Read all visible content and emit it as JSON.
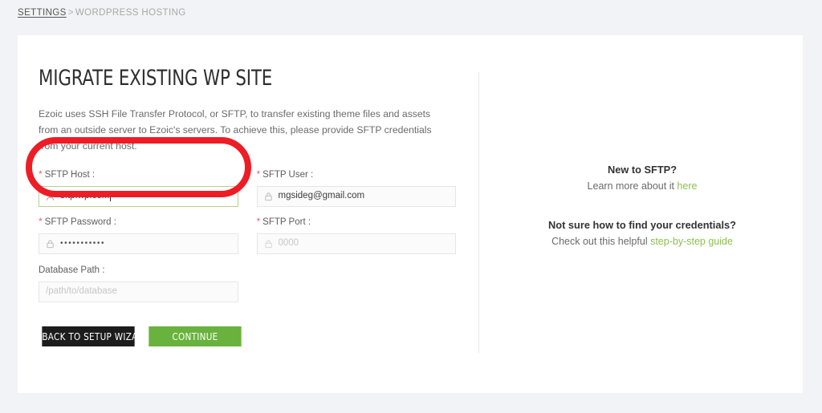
{
  "breadcrumb": {
    "parent": "SETTINGS",
    "separator": ">",
    "current": "WORDPRESS HOSTING"
  },
  "main": {
    "title": "MIGRATE EXISTING WP SITE",
    "description": "Ezoic uses SSH File Transfer Protocol, or SFTP, to transfer existing theme files and assets from an outside server to Ezoic's servers. To achieve this, please provide SFTP credentials from your current host."
  },
  "form": {
    "required_marker": "*",
    "fields": {
      "sftp_host": {
        "label": "SFTP Host :",
        "value": "sftp.wp.com",
        "placeholder": "",
        "icon": "user-icon",
        "required": true,
        "focused": true
      },
      "sftp_user": {
        "label": "SFTP User :",
        "value": "mgsideg@gmail.com",
        "placeholder": "",
        "icon": "lock-icon",
        "required": true,
        "focused": false
      },
      "sftp_password": {
        "label": "SFTP Password :",
        "value": "•••••••••••",
        "placeholder": "",
        "icon": "lock-icon",
        "required": true,
        "focused": false
      },
      "sftp_port": {
        "label": "SFTP Port :",
        "value": "",
        "placeholder": "0000",
        "icon": "lock-icon",
        "required": true,
        "focused": false
      },
      "database_path": {
        "label": "Database Path :",
        "value": "",
        "placeholder": "/path/to/database",
        "icon": "none",
        "required": false,
        "focused": false
      }
    },
    "buttons": {
      "back": "BACK TO SETUP WIZARD",
      "continue": "CONTINUE"
    }
  },
  "help": {
    "block1": {
      "title": "New to SFTP?",
      "text": "Learn more about it ",
      "link": "here"
    },
    "block2": {
      "title": "Not sure how to find your credentials?",
      "text": "Check out this helpful ",
      "link": "step-by-step guide"
    }
  },
  "annotation": {
    "shape": "rounded-rectangle-highlight",
    "color": "#ee1c25",
    "target": "sftp-host-field"
  },
  "colors": {
    "page_background": "#f1f3f6",
    "card_background": "#ffffff",
    "accent_green": "#69b23d",
    "link_green": "#8cbf4d",
    "dark_button": "#1c1c1c",
    "required_red": "#e8636c",
    "annotation_red": "#ee1c25",
    "focus_border": "#b9cf8f"
  }
}
